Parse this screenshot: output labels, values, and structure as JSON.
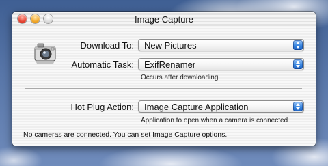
{
  "window": {
    "title": "Image Capture"
  },
  "icons": {
    "app": "camera-icon",
    "close": "close-button",
    "minimize": "minimize-button",
    "zoom": "zoom-button"
  },
  "colors": {
    "close": "#e5402f",
    "minimize": "#f0a525",
    "popup_arrows": "#3a87e0"
  },
  "download_to": {
    "label": "Download To:",
    "value": "New Pictures"
  },
  "automatic_task": {
    "label": "Automatic Task:",
    "value": "ExifRenamer",
    "hint": "Occurs after downloading"
  },
  "hot_plug": {
    "label": "Hot Plug Action:",
    "value": "Image Capture Application",
    "hint": "Application to open when a camera is connected"
  },
  "status": {
    "text": "No cameras are connected. You can set Image Capture options."
  }
}
